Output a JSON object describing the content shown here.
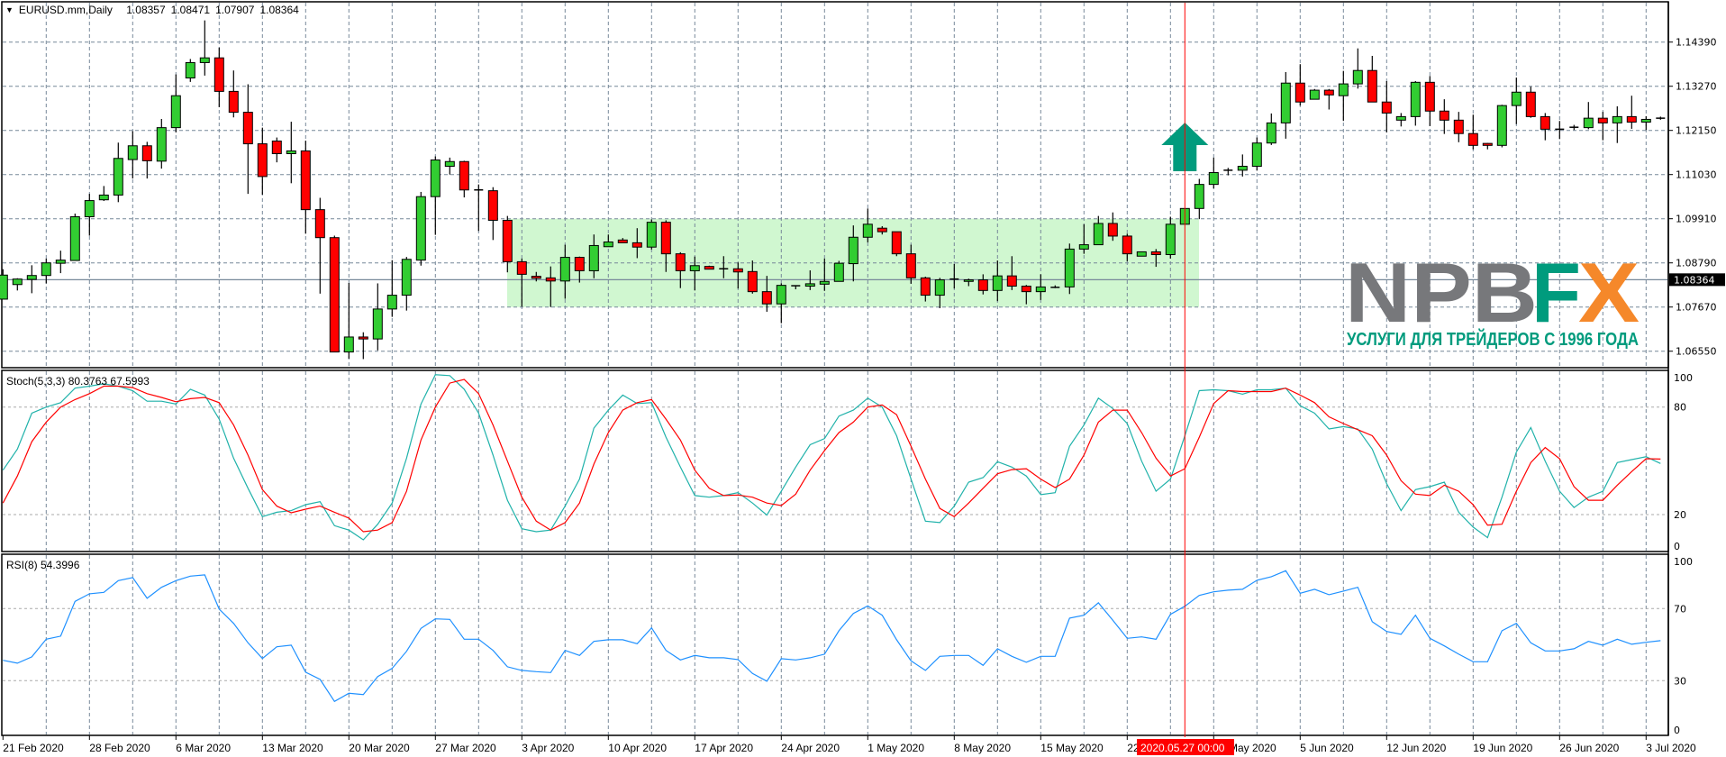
{
  "header": {
    "menu_icon": "triangle-down-icon",
    "symbol": "EURUSD.mm,Daily",
    "open": "1.08357",
    "high": "1.08471",
    "low": "1.07907",
    "close": "1.08364"
  },
  "price_axis": {
    "labels": [
      "1.14390",
      "1.13270",
      "1.12150",
      "1.11030",
      "1.09910",
      "1.08790",
      "1.07670",
      "1.06550"
    ],
    "current_price": "1.08364"
  },
  "stoch": {
    "label": "Stoch(5,3,3) 80.3763 67.5993",
    "axis_labels": [
      "100",
      "80",
      "20",
      "0"
    ],
    "k_color": "#20b2aa",
    "d_color": "#ff0000"
  },
  "rsi": {
    "label": "RSI(8) 54.3996",
    "axis_labels": [
      "100",
      "70",
      "30",
      "0"
    ],
    "color": "#1e90ff"
  },
  "time_axis": {
    "labels": [
      "21 Feb 2020",
      "28 Feb 2020",
      "6 Mar 2020",
      "13 Mar 2020",
      "20 Mar 2020",
      "27 Mar 2020",
      "3 Apr 2020",
      "10 Apr 2020",
      "17 Apr 2020",
      "24 Apr 2020",
      "1 May 2020",
      "8 May 2020",
      "15 May 2020",
      "22 May 2020",
      "29 May 2020",
      "5 Jun 2020",
      "12 Jun 2020",
      "19 Jun 2020",
      "26 Jun 2020",
      "3 Jul 2020"
    ],
    "crosshair_label": "2020.05.27 00:00"
  },
  "logo": {
    "text_gray": "NPB",
    "text_teal": "F",
    "text_orange": "X",
    "tagline": "УСЛУГИ ДЛЯ ТРЕЙДЕРОВ С 1996 ГОДА",
    "gray": "#77787b",
    "teal": "#009b7d",
    "orange": "#f5882a"
  },
  "colors": {
    "bull": "#32cd32",
    "bear": "#ff0000",
    "grid": "#778899",
    "range_box": "#d0f7d0",
    "arrow": "#009b7d",
    "crosshair": "#ff0000"
  },
  "annotations": {
    "range_box": {
      "from_bar": 35,
      "to_bar": 82,
      "top": 1.0991,
      "bottom": 1.0767
    },
    "arrow_bar": 82,
    "crosshair_bar": 82
  },
  "chart_data": {
    "type": "candlestick",
    "title": "EURUSD.mm,Daily",
    "ylim": [
      1.0627,
      1.1523
    ],
    "candles_ohlc": [
      [
        1.0787,
        1.0863,
        1.0787,
        1.0848
      ],
      [
        1.0824,
        1.084,
        1.0809,
        1.0838
      ],
      [
        1.0837,
        1.0873,
        1.0802,
        1.0847
      ],
      [
        1.0847,
        1.089,
        1.0827,
        1.0879
      ],
      [
        1.0878,
        1.091,
        1.0853,
        1.0886
      ],
      [
        1.0885,
        1.1004,
        1.0884,
        1.0996
      ],
      [
        1.0996,
        1.1054,
        1.0948,
        1.1037
      ],
      [
        1.1039,
        1.1074,
        1.1036,
        1.1051
      ],
      [
        1.1051,
        1.1184,
        1.1033,
        1.1144
      ],
      [
        1.1141,
        1.1213,
        1.1093,
        1.1176
      ],
      [
        1.1176,
        1.1186,
        1.1093,
        1.1138
      ],
      [
        1.1137,
        1.1244,
        1.1118,
        1.1222
      ],
      [
        1.1222,
        1.1357,
        1.121,
        1.1303
      ],
      [
        1.1348,
        1.1396,
        1.1338,
        1.1387
      ],
      [
        1.1387,
        1.1494,
        1.1354,
        1.1399
      ],
      [
        1.1399,
        1.1425,
        1.1274,
        1.1314
      ],
      [
        1.1314,
        1.1367,
        1.1248,
        1.1261
      ],
      [
        1.1261,
        1.1332,
        1.1054,
        1.1181
      ],
      [
        1.1181,
        1.1222,
        1.1052,
        1.1098
      ],
      [
        1.1188,
        1.1197,
        1.1134,
        1.1156
      ],
      [
        1.1156,
        1.1237,
        1.1081,
        1.1163
      ],
      [
        1.1163,
        1.1189,
        1.0953,
        1.1014
      ],
      [
        1.1014,
        1.1044,
        1.0801,
        1.0943
      ],
      [
        1.0943,
        1.0948,
        1.0653,
        1.0653
      ],
      [
        1.0653,
        1.0828,
        1.0636,
        1.0691
      ],
      [
        1.0691,
        1.0703,
        1.0635,
        1.0686
      ],
      [
        1.0686,
        1.0827,
        1.0657,
        1.0762
      ],
      [
        1.0762,
        1.0886,
        1.0742,
        1.0797
      ],
      [
        1.0797,
        1.0894,
        1.0758,
        1.0888
      ],
      [
        1.0886,
        1.1059,
        1.0872,
        1.1047
      ],
      [
        1.1047,
        1.1149,
        1.095,
        1.114
      ],
      [
        1.1124,
        1.1146,
        1.1103,
        1.1136
      ],
      [
        1.1136,
        1.1138,
        1.1045,
        1.1064
      ],
      [
        1.1064,
        1.1078,
        1.096,
        1.1062
      ],
      [
        1.1062,
        1.1071,
        1.0937,
        1.0987
      ],
      [
        1.0987,
        1.0998,
        1.0855,
        1.0882
      ],
      [
        1.0882,
        1.089,
        1.0768,
        1.085
      ],
      [
        1.0845,
        1.0856,
        1.0832,
        1.084
      ],
      [
        1.0841,
        1.087,
        1.0767,
        1.0833
      ],
      [
        1.0833,
        1.0925,
        1.0788,
        1.0893
      ],
      [
        1.0893,
        1.0895,
        1.0829,
        1.0859
      ],
      [
        1.0859,
        1.0951,
        1.084,
        1.0923
      ],
      [
        1.092,
        1.0951,
        1.092,
        1.0932
      ],
      [
        1.0937,
        1.0942,
        1.093,
        1.093
      ],
      [
        1.093,
        1.0967,
        1.0891,
        1.0919
      ],
      [
        1.0919,
        1.0989,
        1.0913,
        1.0982
      ],
      [
        1.0982,
        1.0987,
        1.0856,
        1.0902
      ],
      [
        1.0902,
        1.0906,
        1.0815,
        1.0859
      ],
      [
        1.0859,
        1.0895,
        1.0809,
        1.0872
      ],
      [
        1.087,
        1.0872,
        1.0863,
        1.0863
      ],
      [
        1.0864,
        1.0896,
        1.084,
        1.0863
      ],
      [
        1.0864,
        1.088,
        1.0814,
        1.0856
      ],
      [
        1.0857,
        1.0885,
        1.0801,
        1.0806
      ],
      [
        1.0806,
        1.0846,
        1.0755,
        1.0775
      ],
      [
        1.0775,
        1.0827,
        1.0726,
        1.0822
      ],
      [
        1.0821,
        1.0821,
        1.0812,
        1.082
      ],
      [
        1.082,
        1.086,
        1.081,
        1.0826
      ],
      [
        1.0825,
        1.089,
        1.0808,
        1.0832
      ],
      [
        1.0832,
        1.0884,
        1.0832,
        1.0878
      ],
      [
        1.0877,
        1.0974,
        1.0832,
        1.0944
      ],
      [
        1.0944,
        1.1017,
        1.0931,
        1.0977
      ],
      [
        1.0967,
        1.0972,
        1.0951,
        1.0958
      ],
      [
        1.0958,
        1.0958,
        1.0896,
        1.0902
      ],
      [
        1.0902,
        1.0925,
        1.0826,
        1.0841
      ],
      [
        1.0841,
        1.0844,
        1.0781,
        1.0797
      ],
      [
        1.0797,
        1.0841,
        1.0764,
        1.0836
      ],
      [
        1.0836,
        1.0876,
        1.0814,
        1.0838
      ],
      [
        1.0832,
        1.0839,
        1.082,
        1.0836
      ],
      [
        1.0836,
        1.085,
        1.0799,
        1.0809
      ],
      [
        1.0809,
        1.0885,
        1.0782,
        1.0846
      ],
      [
        1.0846,
        1.0896,
        1.081,
        1.082
      ],
      [
        1.082,
        1.0823,
        1.0774,
        1.0806
      ],
      [
        1.0806,
        1.085,
        1.0785,
        1.0818
      ],
      [
        1.0817,
        1.0822,
        1.0815,
        1.0817
      ],
      [
        1.0818,
        1.0928,
        1.08,
        1.0914
      ],
      [
        1.0914,
        1.0977,
        1.0902,
        1.0925
      ],
      [
        1.0925,
        1.0998,
        1.0925,
        1.0979
      ],
      [
        1.0979,
        1.1007,
        1.0935,
        1.0947
      ],
      [
        1.0947,
        1.0953,
        1.0883,
        1.0902
      ],
      [
        1.0896,
        1.0907,
        1.0896,
        1.0907
      ],
      [
        1.0907,
        1.0914,
        1.0869,
        1.09
      ],
      [
        1.09,
        1.0996,
        1.089,
        1.0977
      ],
      [
        1.0977,
        1.1017,
        1.0977,
        1.1017
      ],
      [
        1.1017,
        1.1092,
        1.099,
        1.1078
      ],
      [
        1.1078,
        1.1146,
        1.1068,
        1.1108
      ],
      [
        1.1112,
        1.112,
        1.1101,
        1.1114
      ],
      [
        1.1114,
        1.1154,
        1.1098,
        1.1124
      ],
      [
        1.1124,
        1.1197,
        1.1113,
        1.1183
      ],
      [
        1.1183,
        1.1258,
        1.1178,
        1.1234
      ],
      [
        1.1234,
        1.1363,
        1.1194,
        1.1335
      ],
      [
        1.1335,
        1.1383,
        1.1278,
        1.1287
      ],
      [
        1.1294,
        1.132,
        1.1294,
        1.1317
      ],
      [
        1.1317,
        1.132,
        1.1268,
        1.1305
      ],
      [
        1.1303,
        1.1366,
        1.1239,
        1.1333
      ],
      [
        1.1333,
        1.1423,
        1.1321,
        1.1367
      ],
      [
        1.1367,
        1.1404,
        1.1287,
        1.1287
      ],
      [
        1.1287,
        1.134,
        1.121,
        1.1259
      ],
      [
        1.1241,
        1.1259,
        1.1225,
        1.125
      ],
      [
        1.125,
        1.134,
        1.1227,
        1.1337
      ],
      [
        1.1337,
        1.1353,
        1.1226,
        1.1264
      ],
      [
        1.1264,
        1.1294,
        1.1206,
        1.1241
      ],
      [
        1.1241,
        1.1262,
        1.1185,
        1.1207
      ],
      [
        1.1207,
        1.1255,
        1.1167,
        1.1177
      ],
      [
        1.1182,
        1.1183,
        1.1167,
        1.1177
      ],
      [
        1.1177,
        1.128,
        1.1172,
        1.1278
      ],
      [
        1.1278,
        1.1349,
        1.1231,
        1.1312
      ],
      [
        1.1312,
        1.1326,
        1.1247,
        1.125
      ],
      [
        1.125,
        1.1259,
        1.119,
        1.1218
      ],
      [
        1.1218,
        1.1239,
        1.1193,
        1.1218
      ],
      [
        1.1222,
        1.1229,
        1.1216,
        1.1223
      ],
      [
        1.1222,
        1.1287,
        1.1218,
        1.1246
      ],
      [
        1.1246,
        1.1262,
        1.119,
        1.1234
      ],
      [
        1.1234,
        1.1276,
        1.1183,
        1.125
      ],
      [
        1.125,
        1.1303,
        1.1219,
        1.1236
      ],
      [
        1.1236,
        1.1251,
        1.1216,
        1.1243
      ],
      [
        1.1245,
        1.125,
        1.1242,
        1.1246
      ]
    ],
    "stoch_k": [
      44.8,
      56.5,
      76.6,
      80,
      82.5,
      90.6,
      91.7,
      93,
      91.7,
      89.2,
      83.3,
      83.3,
      81.7,
      90,
      86.7,
      73.3,
      51.5,
      34.7,
      18.8,
      21.3,
      22.2,
      25.5,
      27.2,
      13.8,
      11.3,
      5.9,
      14.6,
      26.4,
      51.5,
      81.7,
      98.1,
      97.6,
      90,
      76.6,
      53.2,
      28,
      12.1,
      10.4,
      11.3,
      24.7,
      39.8,
      68.3,
      78.3,
      86.7,
      82,
      82.5,
      63.2,
      46.5,
      30.6,
      29.7,
      30.6,
      32.2,
      26.4,
      19.7,
      33,
      46.5,
      59,
      62.4,
      75,
      78.3,
      85,
      80,
      64,
      39.8,
      16.3,
      15.5,
      24.7,
      38.1,
      40.6,
      49.5,
      46.5,
      41.5,
      31.1,
      32.2,
      58.2,
      70,
      85,
      79.2,
      70.8,
      49.8,
      33,
      39.8,
      64,
      89.2,
      89.7,
      89.2,
      87.2,
      89.7,
      89.7,
      90.6,
      80.8,
      76.6,
      67.8,
      69.1,
      67.8,
      56.5,
      37.3,
      22.2,
      33.9,
      35.6,
      38.1,
      21.3,
      13,
      7.1,
      29.7,
      54.9,
      68.6,
      49.8,
      33,
      23.9,
      29.7,
      33,
      49,
      50.7,
      52.3,
      48.5
    ],
    "stoch_d": [
      26.4,
      41.5,
      60.7,
      71.6,
      80,
      84.2,
      87.5,
      91.7,
      91.7,
      90.9,
      87.5,
      85.4,
      83,
      84.7,
      85.4,
      82.5,
      70,
      53.2,
      33.9,
      24.7,
      21,
      23,
      24.7,
      21.3,
      18,
      10.4,
      11.3,
      15.5,
      33,
      61.6,
      80,
      93.4,
      95.4,
      87.5,
      70,
      49.8,
      29.7,
      16.3,
      11.3,
      15.5,
      26.4,
      48.2,
      65.8,
      78.3,
      82.5,
      84.2,
      73.3,
      61.6,
      44.8,
      34.7,
      30.6,
      30.9,
      29.7,
      26.4,
      25,
      31.4,
      44.8,
      55.7,
      65.8,
      71.6,
      80,
      81.2,
      75.8,
      58.2,
      39.8,
      23.4,
      18.8,
      26.4,
      34.7,
      42.8,
      45.1,
      45.6,
      39.8,
      35.1,
      39.8,
      53.2,
      71.6,
      78.3,
      78.3,
      65.8,
      51.5,
      41.5,
      45.6,
      63.2,
      82,
      89.2,
      88.7,
      88.7,
      88.7,
      90.6,
      86.7,
      82.5,
      74.6,
      70.8,
      67.4,
      64,
      53.2,
      38.9,
      31.4,
      30.6,
      36.4,
      33,
      25.5,
      14.1,
      14.6,
      33,
      49,
      57.4,
      51.2,
      35.6,
      28,
      28,
      36.4,
      44,
      51.2,
      51
    ],
    "rsi": [
      41.3,
      39.7,
      43.2,
      53,
      54.7,
      74,
      78.2,
      79,
      85.5,
      87.2,
      75.7,
      81.8,
      85.5,
      88,
      88.7,
      69.7,
      61.8,
      51,
      42.3,
      48.8,
      49.7,
      34.7,
      30.7,
      18.5,
      23,
      22.3,
      32.3,
      36.8,
      46.3,
      59,
      64.3,
      64,
      53,
      53,
      46.8,
      37.7,
      35.7,
      35,
      34.5,
      46.8,
      44,
      51.8,
      52.7,
      52.7,
      50.5,
      59.3,
      46.8,
      41.5,
      44,
      42.7,
      42.7,
      41.7,
      34,
      29.7,
      42.2,
      41.5,
      42.7,
      44.7,
      57.7,
      67.3,
      71.5,
      66.3,
      52.7,
      41,
      35.7,
      43.5,
      44,
      44,
      38.5,
      47.7,
      43.5,
      40.2,
      43.5,
      43.5,
      64.7,
      66.3,
      73.2,
      63.5,
      53.5,
      54.3,
      53,
      66.8,
      71.3,
      77.3,
      79.3,
      80.2,
      80.7,
      85.7,
      87.7,
      91,
      78.5,
      80.7,
      77.7,
      79.7,
      81.8,
      62.7,
      57.3,
      55.7,
      66.3,
      53.5,
      49.3,
      44.7,
      40.5,
      40.5,
      57.7,
      61.8,
      51,
      46.5,
      46.5,
      47.7,
      51.8,
      49.7,
      53,
      50.2,
      51.3,
      52.2
    ]
  }
}
